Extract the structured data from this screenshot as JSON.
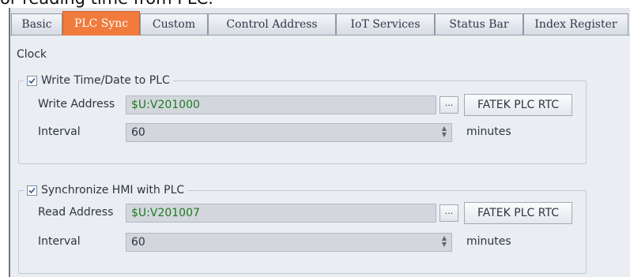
{
  "cut_text": "or reading time from PLC.",
  "tabs": [
    {
      "label": "Basic"
    },
    {
      "label": "PLC Sync"
    },
    {
      "label": "Custom"
    },
    {
      "label": "Control Address"
    },
    {
      "label": "IoT Services"
    },
    {
      "label": "Status Bar"
    },
    {
      "label": "Index Register"
    }
  ],
  "active_tab": "PLC Sync",
  "section_title": "Clock",
  "write_group": {
    "checked": true,
    "label": "Write Time/Date to PLC",
    "address_label": "Write Address",
    "address_value": "$U:V201000",
    "browse_label": "...",
    "rtc_button_label": "FATEK PLC RTC",
    "interval_label": "Interval",
    "interval_value": "60",
    "interval_unit": "minutes"
  },
  "sync_group": {
    "checked": true,
    "label": "Synchronize HMI with PLC",
    "address_label": "Read Address",
    "address_value": "$U:V201007",
    "browse_label": "...",
    "rtc_button_label": "FATEK PLC RTC",
    "interval_label": "Interval",
    "interval_value": "60",
    "interval_unit": "minutes"
  },
  "colors": {
    "active_tab": "#f17b3c",
    "address_text": "#1e7a21",
    "panel_bg": "#eaedf2"
  },
  "icons": {
    "checkbox": "checkmark-icon",
    "spinner": "spin-arrows-icon"
  }
}
